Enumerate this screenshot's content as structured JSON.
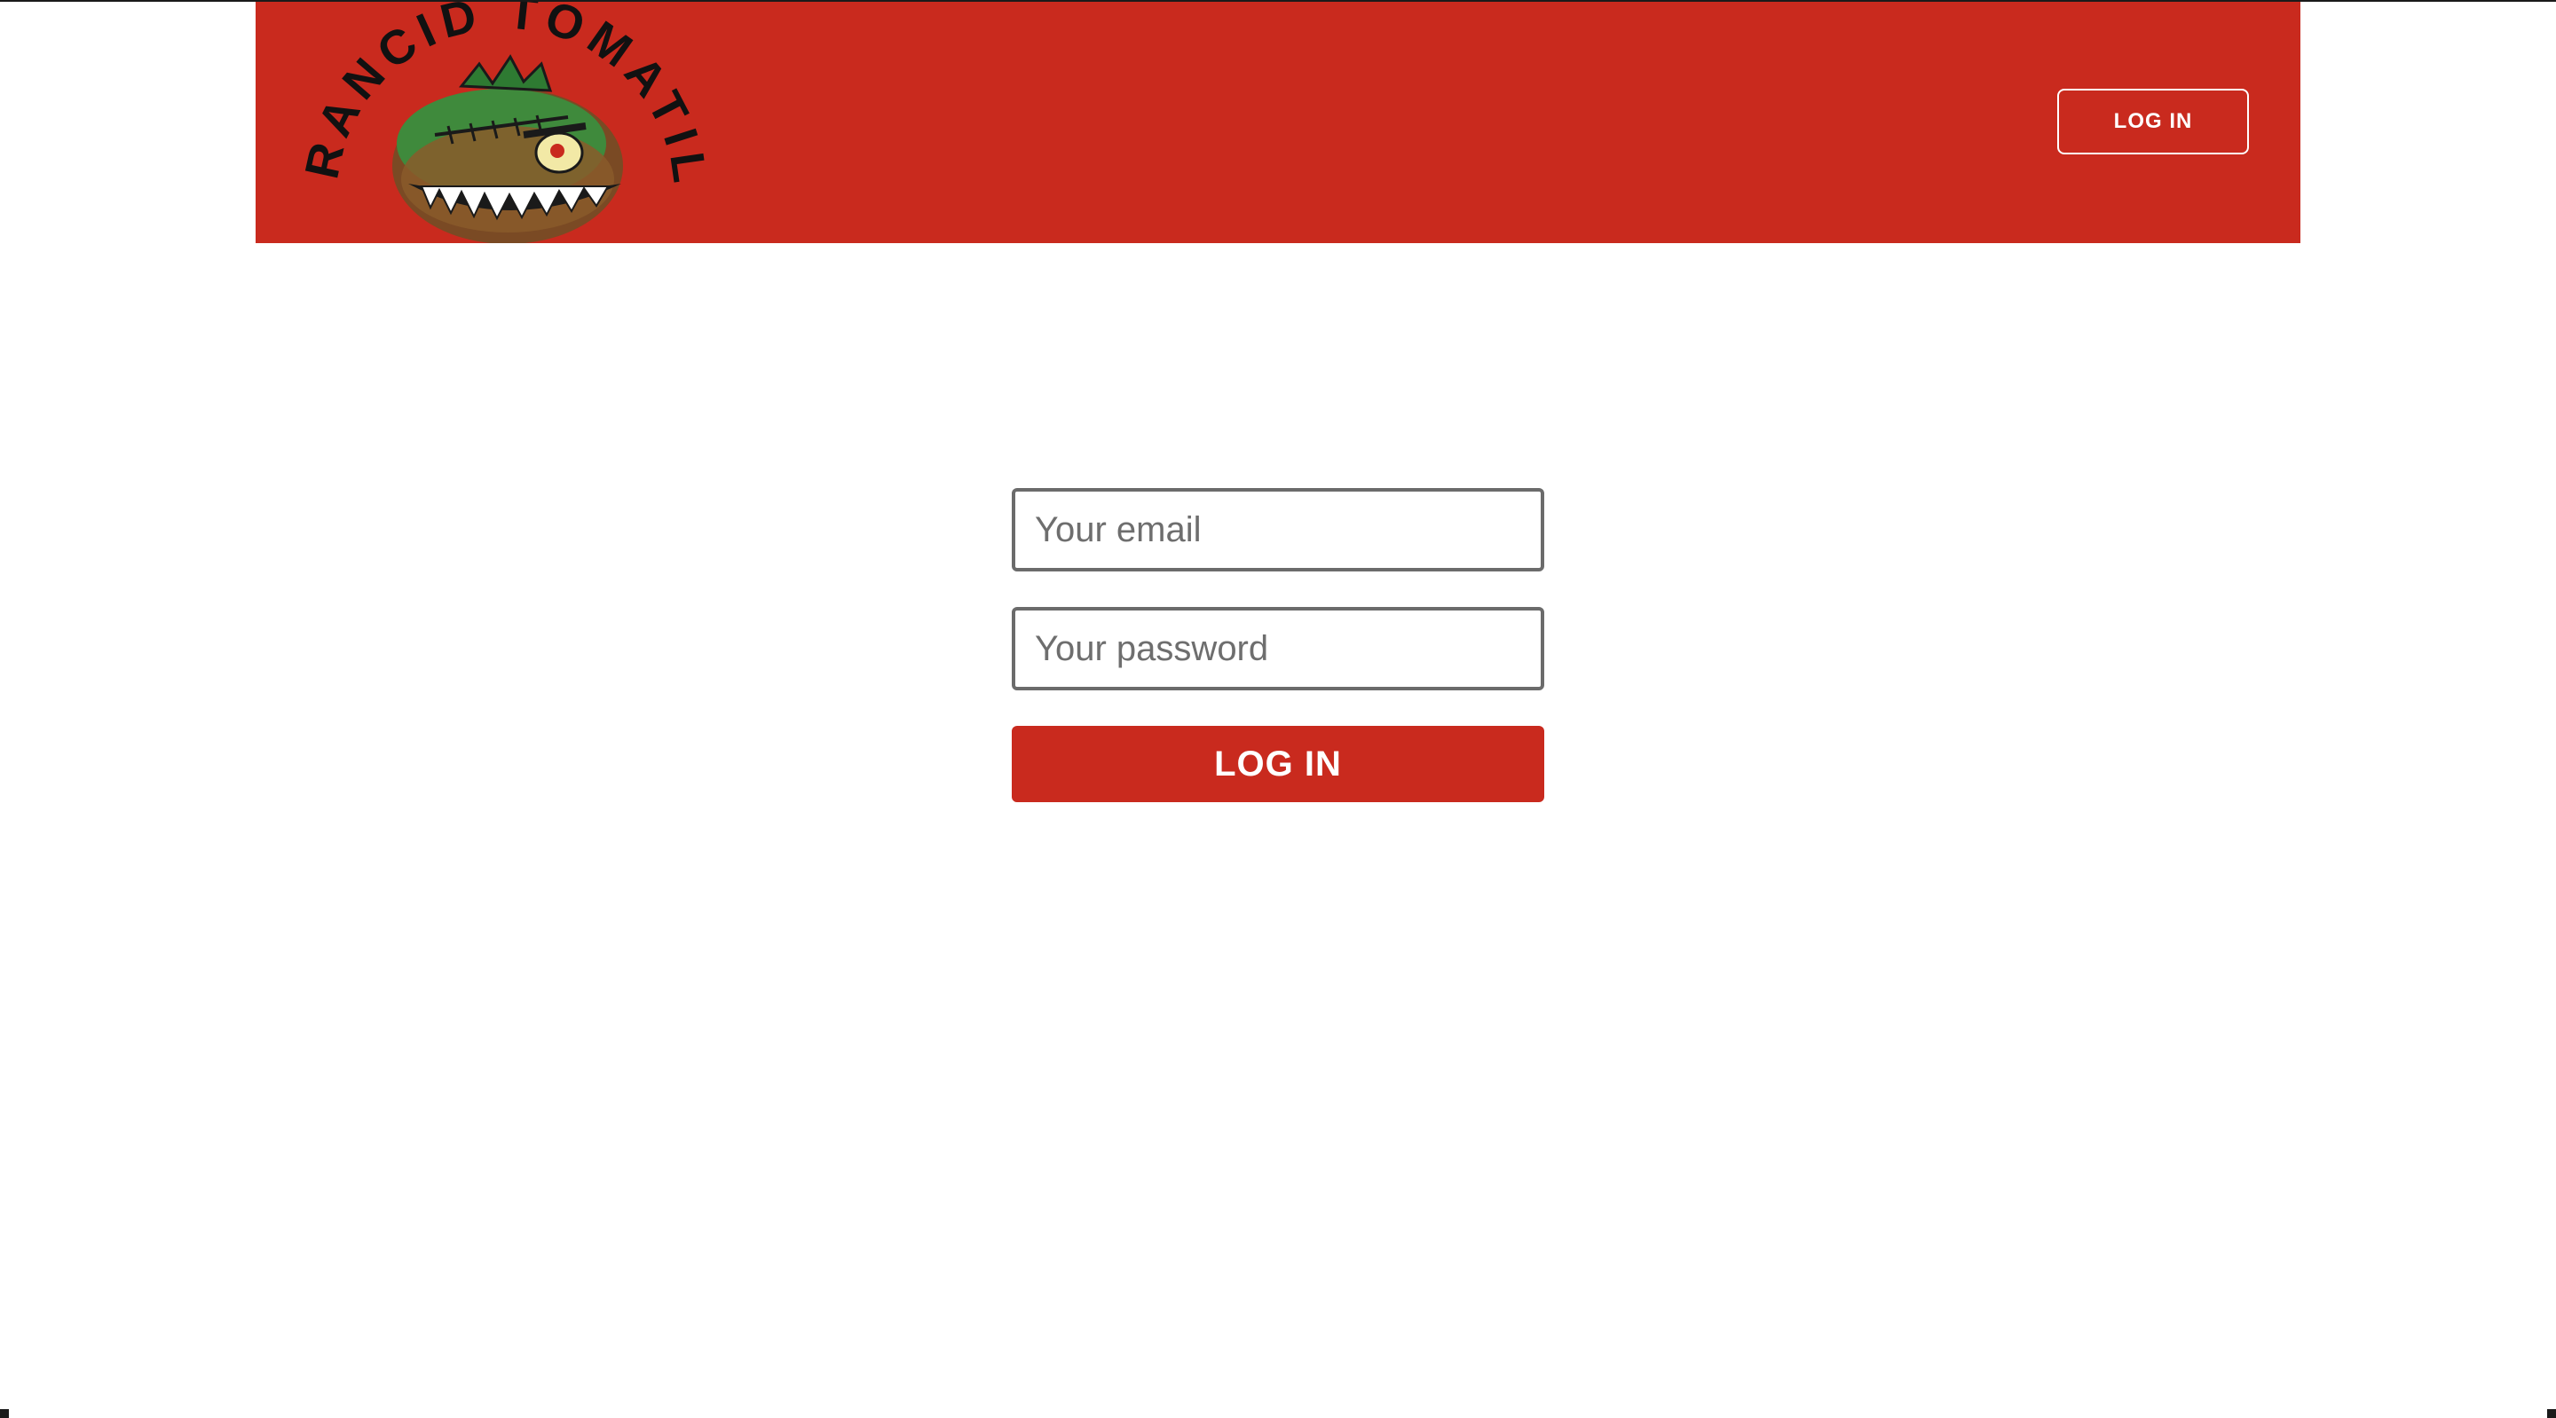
{
  "header": {
    "logo_text": "RANCID TOMATILLOS",
    "login_button": "LOG IN"
  },
  "form": {
    "email_placeholder": "Your email",
    "email_value": "",
    "password_placeholder": "Your password",
    "password_value": "",
    "submit_label": "LOG IN"
  },
  "colors": {
    "brand_red": "#c92a1e",
    "field_border": "#6b6b6b",
    "white": "#ffffff"
  },
  "icons": {
    "logo": "angry-tomatillo-logo"
  }
}
